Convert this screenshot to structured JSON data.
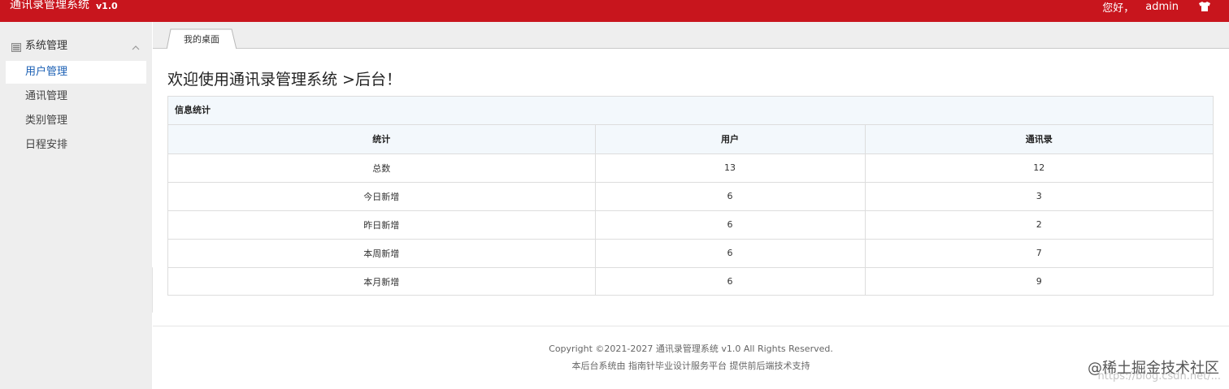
{
  "header": {
    "title": "通讯录管理系统",
    "version": "v1.0",
    "greeting": "您好，",
    "username": "admin",
    "shirt_icon": "tshirt-icon"
  },
  "sidebar": {
    "group": {
      "label": "系统管理",
      "icon": "list-icon"
    },
    "items": [
      {
        "label": "用户管理",
        "active": true
      },
      {
        "label": "通讯管理",
        "active": false
      },
      {
        "label": "类别管理",
        "active": false
      },
      {
        "label": "日程安排",
        "active": false
      }
    ]
  },
  "tabs": [
    {
      "label": "我的桌面"
    }
  ],
  "main": {
    "welcome": "欢迎使用通讯录管理系统 >后台！",
    "panel_title": "信息统计",
    "table": {
      "headers": [
        "统计",
        "用户",
        "通讯录"
      ],
      "rows": [
        [
          "总数",
          "13",
          "12"
        ],
        [
          "今日新增",
          "6",
          "3"
        ],
        [
          "昨日新增",
          "6",
          "2"
        ],
        [
          "本周新增",
          "6",
          "7"
        ],
        [
          "本月新增",
          "6",
          "9"
        ]
      ]
    }
  },
  "footer": {
    "copyright": "Copyright ©2021-2027 通讯录管理系统 v1.0 All Rights Reserved.",
    "support": "本后台系统由 指南针毕业设计服务平台 提供前后端技术支持"
  },
  "watermark": {
    "text": "@稀土掘金技术社区",
    "url": "https://blog.csdn.net/..."
  },
  "colors": {
    "header_bg": "#c8151d",
    "sidebar_bg": "#eeeeee",
    "active_text": "#1a5fb4",
    "table_head_bg": "#f3f8fc"
  }
}
